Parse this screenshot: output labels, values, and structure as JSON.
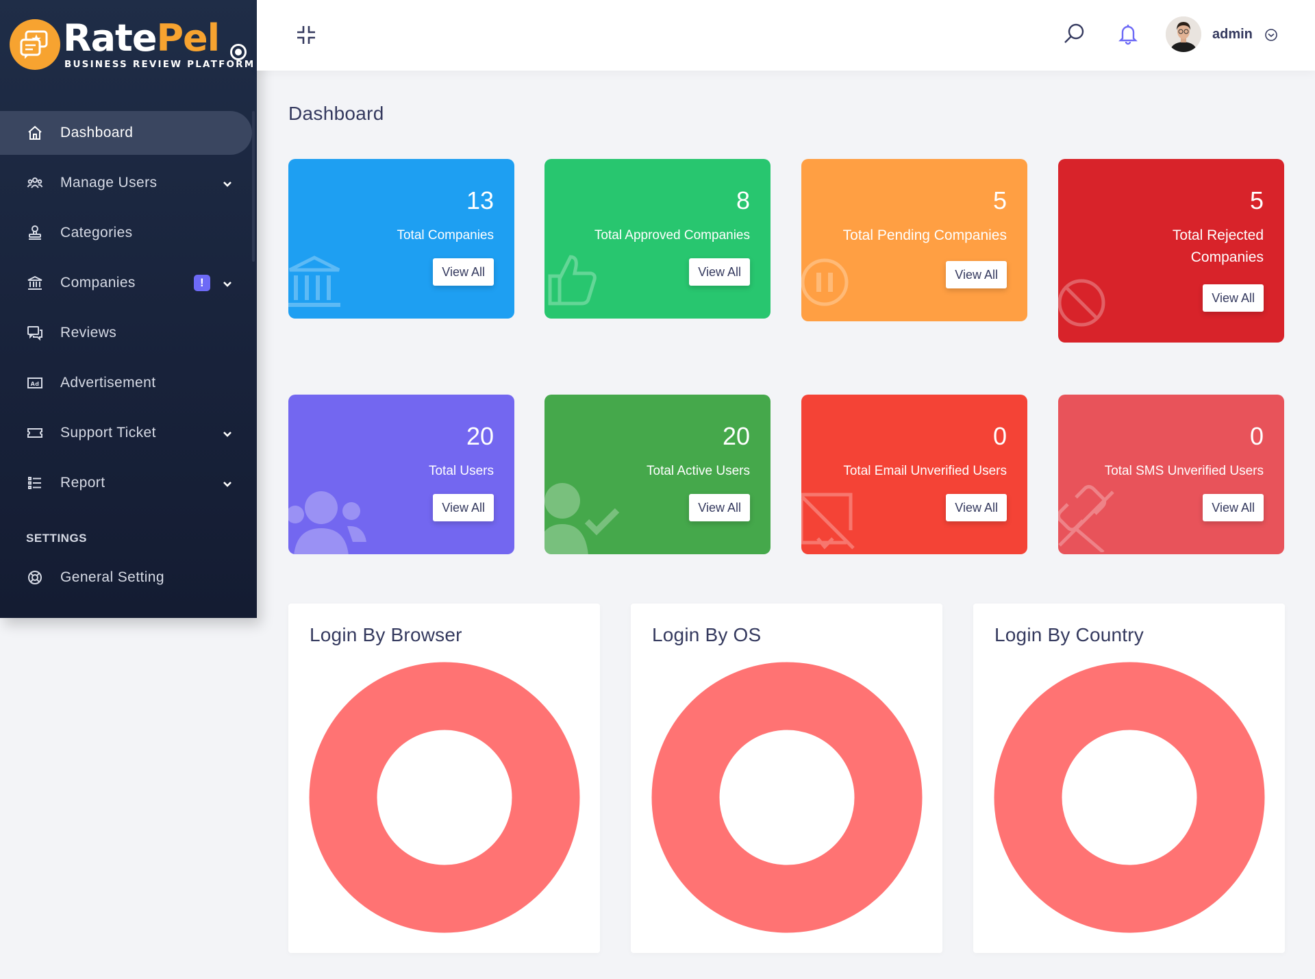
{
  "brand": {
    "name_part1": "Rate",
    "name_part2": "Pel",
    "tagline": "BUSINESS REVIEW PLATFORM",
    "accent": "#f7a330"
  },
  "sidebar": {
    "items": [
      {
        "label": "Dashboard",
        "icon": "home-icon",
        "active": true
      },
      {
        "label": "Manage Users",
        "icon": "users-icon",
        "has_submenu": true
      },
      {
        "label": "Categories",
        "icon": "stamp-icon"
      },
      {
        "label": "Companies",
        "icon": "bank-icon",
        "has_submenu": true,
        "badge": "!"
      },
      {
        "label": "Reviews",
        "icon": "chat-icon"
      },
      {
        "label": "Advertisement",
        "icon": "ad-icon"
      },
      {
        "label": "Support Ticket",
        "icon": "ticket-icon",
        "has_submenu": true
      },
      {
        "label": "Report",
        "icon": "list-icon",
        "has_submenu": true
      }
    ],
    "settings_heading": "SETTINGS",
    "settings_items": [
      {
        "label": "General Setting",
        "icon": "lifebuoy-icon"
      }
    ]
  },
  "topbar": {
    "username": "admin",
    "icons": [
      "collapse-icon",
      "search-icon",
      "bell-icon",
      "chevron-down-icon"
    ]
  },
  "page": {
    "title": "Dashboard"
  },
  "stat_cards": [
    {
      "value": "13",
      "label": "Total Companies",
      "button": "View All",
      "color": "#1e9ff2",
      "icon": "bank-icon"
    },
    {
      "value": "8",
      "label": "Total Approved Companies",
      "button": "View All",
      "color": "#28c66f",
      "icon": "thumbs-up-icon"
    },
    {
      "value": "5",
      "label": "Total Pending Companies",
      "button": "View All",
      "color": "#ff9f43",
      "icon": "pause-icon"
    },
    {
      "value": "5",
      "label": "Total Rejected Companies",
      "button": "View All",
      "color": "#d8232a",
      "icon": "ban-icon"
    },
    {
      "value": "20",
      "label": "Total Users",
      "button": "View All",
      "color": "#7367f0",
      "icon": "users-icon"
    },
    {
      "value": "20",
      "label": "Total Active Users",
      "button": "View All",
      "color": "#45a84b",
      "icon": "user-check-icon"
    },
    {
      "value": "0",
      "label": "Total Email Unverified Users",
      "button": "View All",
      "color": "#f44336",
      "icon": "email-slash-icon"
    },
    {
      "value": "0",
      "label": "Total SMS Unverified Users",
      "button": "View All",
      "color": "#e8535a",
      "icon": "phone-slash-icon"
    }
  ],
  "charts": [
    {
      "title": "Login By Browser"
    },
    {
      "title": "Login By OS"
    },
    {
      "title": "Login By Country"
    }
  ],
  "chart_data": [
    {
      "type": "pie",
      "title": "Login By Browser",
      "slice_color": "#ff7373"
    },
    {
      "type": "pie",
      "title": "Login By OS",
      "slice_color": "#ff7373"
    },
    {
      "type": "pie",
      "title": "Login By Country",
      "slice_color": "#ff7373"
    }
  ]
}
